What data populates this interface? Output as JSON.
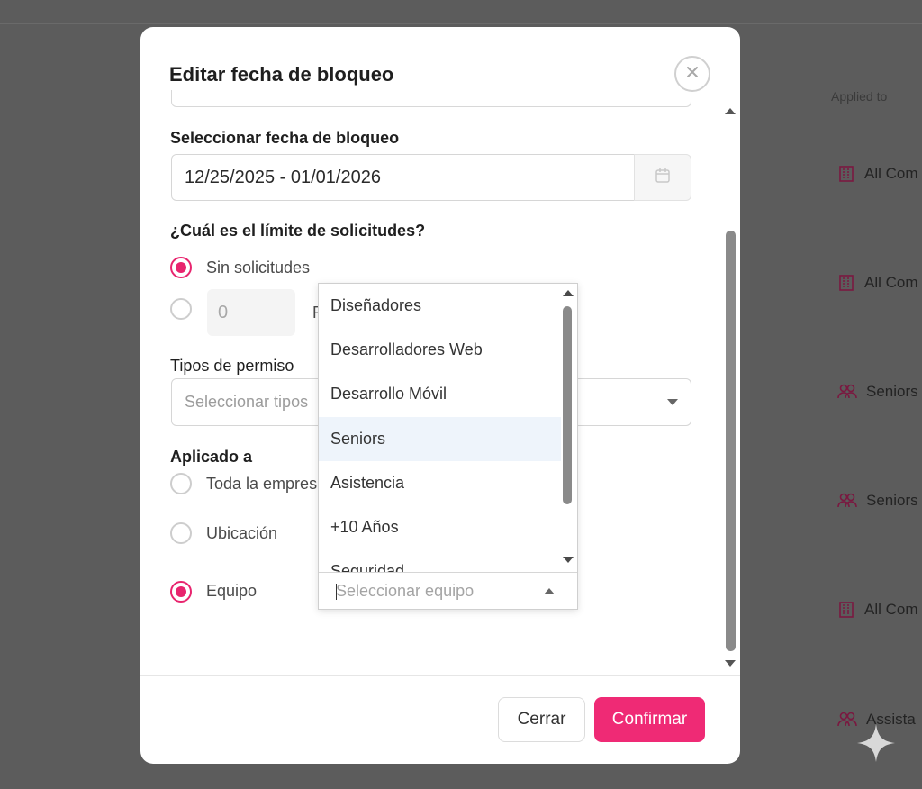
{
  "background": {
    "column_header": "Applied to",
    "rows": [
      {
        "icon": "building-icon",
        "text": "All Com"
      },
      {
        "icon": "building-icon",
        "text": "All Com"
      },
      {
        "icon": "users-icon",
        "text": "Seniors"
      },
      {
        "icon": "users-icon",
        "text": "Seniors"
      },
      {
        "icon": "building-icon",
        "text": "All Com"
      },
      {
        "icon": "users-icon",
        "text": "Assista"
      }
    ]
  },
  "modal": {
    "title": "Editar fecha de bloqueo",
    "date_section": {
      "label": "Seleccionar fecha de bloqueo",
      "value": "12/25/2025 - 01/01/2026",
      "icon": "calendar-icon"
    },
    "limit_section": {
      "label": "¿Cuál es el límite de solicitudes?",
      "option_none": "Sin solicitudes",
      "option_none_selected": true,
      "number_value": "0",
      "number_suffix_partial": "P"
    },
    "leave_types": {
      "label": "Tipos de permiso",
      "placeholder": "Seleccionar tipos"
    },
    "applied_to": {
      "label": "Aplicado a",
      "options": [
        {
          "label": "Toda la empres",
          "selected": false
        },
        {
          "label": "Ubicación",
          "selected": false
        },
        {
          "label": "Equipo",
          "selected": true
        }
      ]
    },
    "team_dropdown": {
      "items": [
        "Diseñadores",
        "Desarrolladores Web",
        "Desarrollo Móvil",
        "Seniors",
        "Asistencia",
        "+10 Años",
        "Seguridad"
      ],
      "highlighted_index": 3,
      "search_placeholder": "Seleccionar equipo"
    },
    "footer": {
      "cancel": "Cerrar",
      "confirm": "Confirmar"
    }
  },
  "colors": {
    "accent": "#ef2a75",
    "overlay": "#5c5c5c",
    "highlight": "#eef4fb"
  }
}
